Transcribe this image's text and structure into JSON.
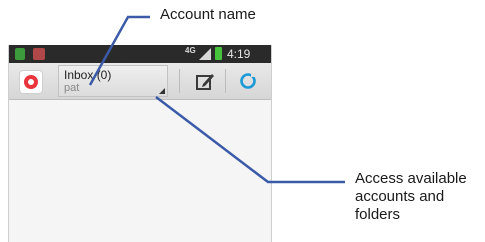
{
  "callouts": {
    "account_name": "Account name",
    "access_line1": "Access available",
    "access_line2": "accounts and",
    "access_line3": "folders"
  },
  "statusbar": {
    "network": "4G",
    "time": "4:19 PM"
  },
  "actionbar": {
    "account_title": "Inbox (0)",
    "account_subtitle": "pat",
    "app_icon": "email-app-icon",
    "compose_icon": "compose-icon",
    "refresh_icon": "refresh-icon"
  },
  "colors": {
    "callout_line": "#3b5aa8",
    "statusbar_bg": "#2a2a2a",
    "actionbar_bg": "#e0e0e0",
    "accent_blue": "#1b9ad7",
    "app_red": "#e8343a"
  }
}
